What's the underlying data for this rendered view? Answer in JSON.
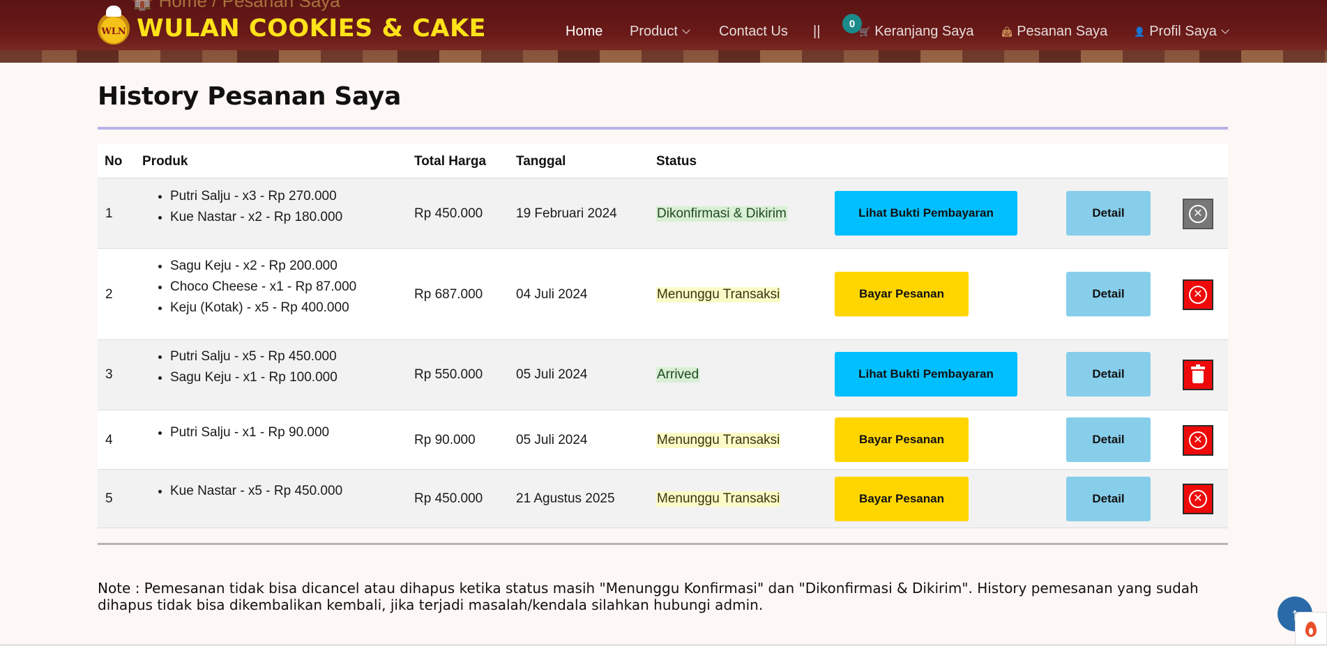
{
  "header": {
    "breadcrumb": "🏠 Home / Pesanan Saya",
    "brand_logo_text": "WLN",
    "brand": "WULAN COOKIES & CAKE",
    "nav": {
      "home": "Home",
      "product": "Product",
      "contact": "Contact Us",
      "separator": "||",
      "cart": "Keranjang Saya",
      "cart_count": "0",
      "orders": "Pesanan Saya",
      "profile": "Profil Saya"
    }
  },
  "page": {
    "title": "History Pesanan Saya"
  },
  "table": {
    "headers": {
      "no": "No",
      "produk": "Produk",
      "total": "Total Harga",
      "tanggal": "Tanggal",
      "status": "Status"
    },
    "rows": [
      {
        "no": "1",
        "items": [
          "Putri Salju - x3 - Rp 270.000",
          "Kue Nastar - x2 - Rp 180.000"
        ],
        "total": "Rp 450.000",
        "date": "19 Februari 2024",
        "status": "Dikonfirmasi & Dikirim",
        "action_label": "Lihat Bukti Pembayaran",
        "detail_label": "Detail"
      },
      {
        "no": "2",
        "items": [
          "Sagu Keju - x2 - Rp 200.000",
          "Choco Cheese - x1 - Rp 87.000",
          "Keju (Kotak) - x5 - Rp 400.000"
        ],
        "total": "Rp 687.000",
        "date": "04 Juli 2024",
        "status": "Menunggu Transaksi",
        "action_label": "Bayar Pesanan",
        "detail_label": "Detail"
      },
      {
        "no": "3",
        "items": [
          "Putri Salju - x5 - Rp 450.000",
          "Sagu Keju - x1 - Rp 100.000"
        ],
        "total": "Rp 550.000",
        "date": "05 Juli 2024",
        "status": "Arrived",
        "action_label": "Lihat Bukti Pembayaran",
        "detail_label": "Detail"
      },
      {
        "no": "4",
        "items": [
          "Putri Salju - x1 - Rp 90.000"
        ],
        "total": "Rp 90.000",
        "date": "05 Juli 2024",
        "status": "Menunggu Transaksi",
        "action_label": "Bayar Pesanan",
        "detail_label": "Detail"
      },
      {
        "no": "5",
        "items": [
          "Kue Nastar - x5 - Rp 450.000"
        ],
        "total": "Rp 450.000",
        "date": "21 Agustus 2025",
        "status": "Menunggu Transaksi",
        "action_label": "Bayar Pesanan",
        "detail_label": "Detail"
      }
    ]
  },
  "note": "Note : Pemesanan tidak bisa dicancel atau dihapus ketika status masih \"Menunggu Konfirmasi\" dan \"Dikonfirmasi & Dikirim\". History pemesanan yang sudah dihapus tidak bisa dikembalikan kembali, jika terjadi masalah/kendala silahkan hubungi admin.",
  "colors": {
    "header_bg": "#6a1a18",
    "brand_yellow": "#ffe21a",
    "btn_blue": "#00bfff",
    "btn_gold": "#ffd500",
    "btn_detail": "#87ceeb",
    "delete_red": "#ee0a0a",
    "cancel_disabled": "#777777"
  },
  "icons": {
    "cart": "cart-icon",
    "orders": "bag-icon",
    "profile": "user-icon",
    "cancel": "cancel-circle-icon",
    "delete": "trash-icon",
    "scroll_top": "arrow-up-icon"
  }
}
